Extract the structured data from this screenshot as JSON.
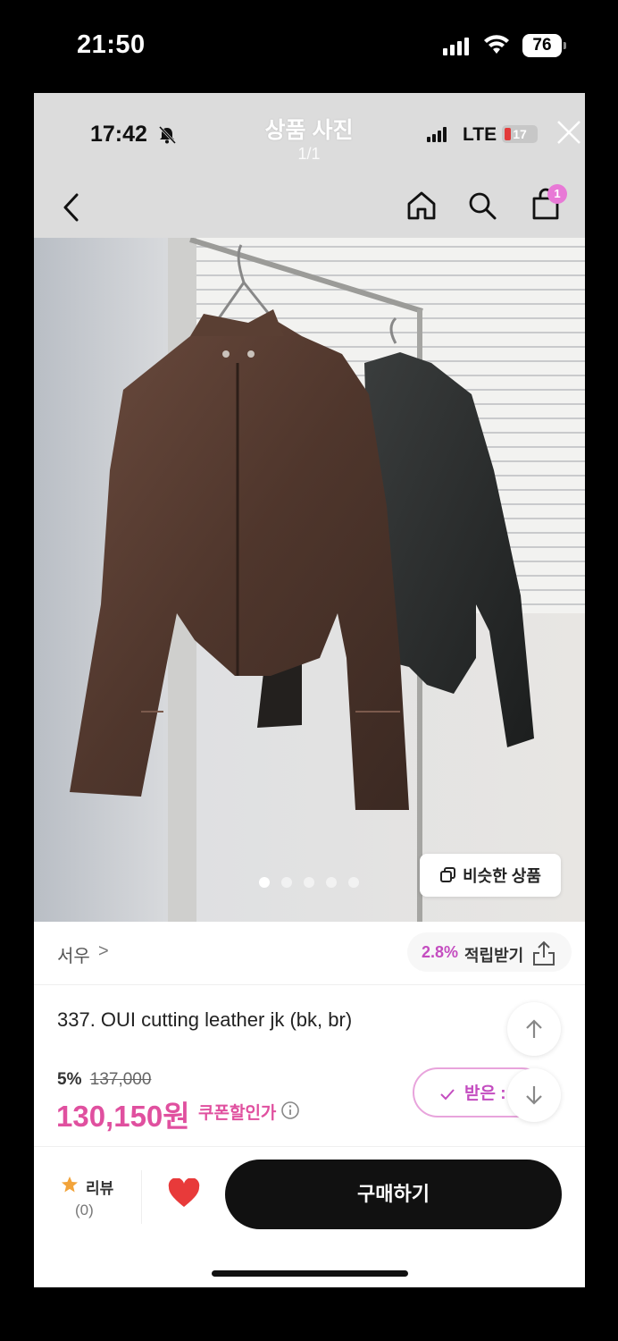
{
  "outer_status": {
    "time": "21:50",
    "battery": "76"
  },
  "inner_status": {
    "time": "17:42",
    "network": "LTE",
    "battery": "17"
  },
  "viewer": {
    "title": "상품 사진",
    "counter": "1/1"
  },
  "nav": {
    "cart_badge": "1"
  },
  "photo": {
    "carousel_dots": 5,
    "active_dot": 0,
    "similar_button": "비슷한 상품"
  },
  "store": {
    "name": "서우",
    "chevron": ">",
    "points_rate": "2.8%",
    "points_label": "적립받기"
  },
  "product": {
    "name": "337. OUI cutting leather jk (bk, br)",
    "discount_rate": "5%",
    "original_price": "137,000",
    "sale_price": "130,150원",
    "coupon_label": "쿠폰할인가",
    "coupon_button": "받은 :"
  },
  "bottom_bar": {
    "review_label": "리뷰",
    "review_count": "(0)",
    "buy_button": "구매하기"
  },
  "colors": {
    "accent": "#e0509f",
    "points": "#c44dc0",
    "heart": "#e83a3a",
    "buy_button": "#111111"
  },
  "icons": [
    "back-icon",
    "home-icon",
    "search-icon",
    "cart-icon",
    "share-icon",
    "info-icon",
    "star-icon",
    "heart-icon",
    "close-icon",
    "bell-slash-icon",
    "wifi-icon",
    "copy-icon",
    "arrow-up-icon",
    "arrow-down-icon",
    "check-icon"
  ]
}
